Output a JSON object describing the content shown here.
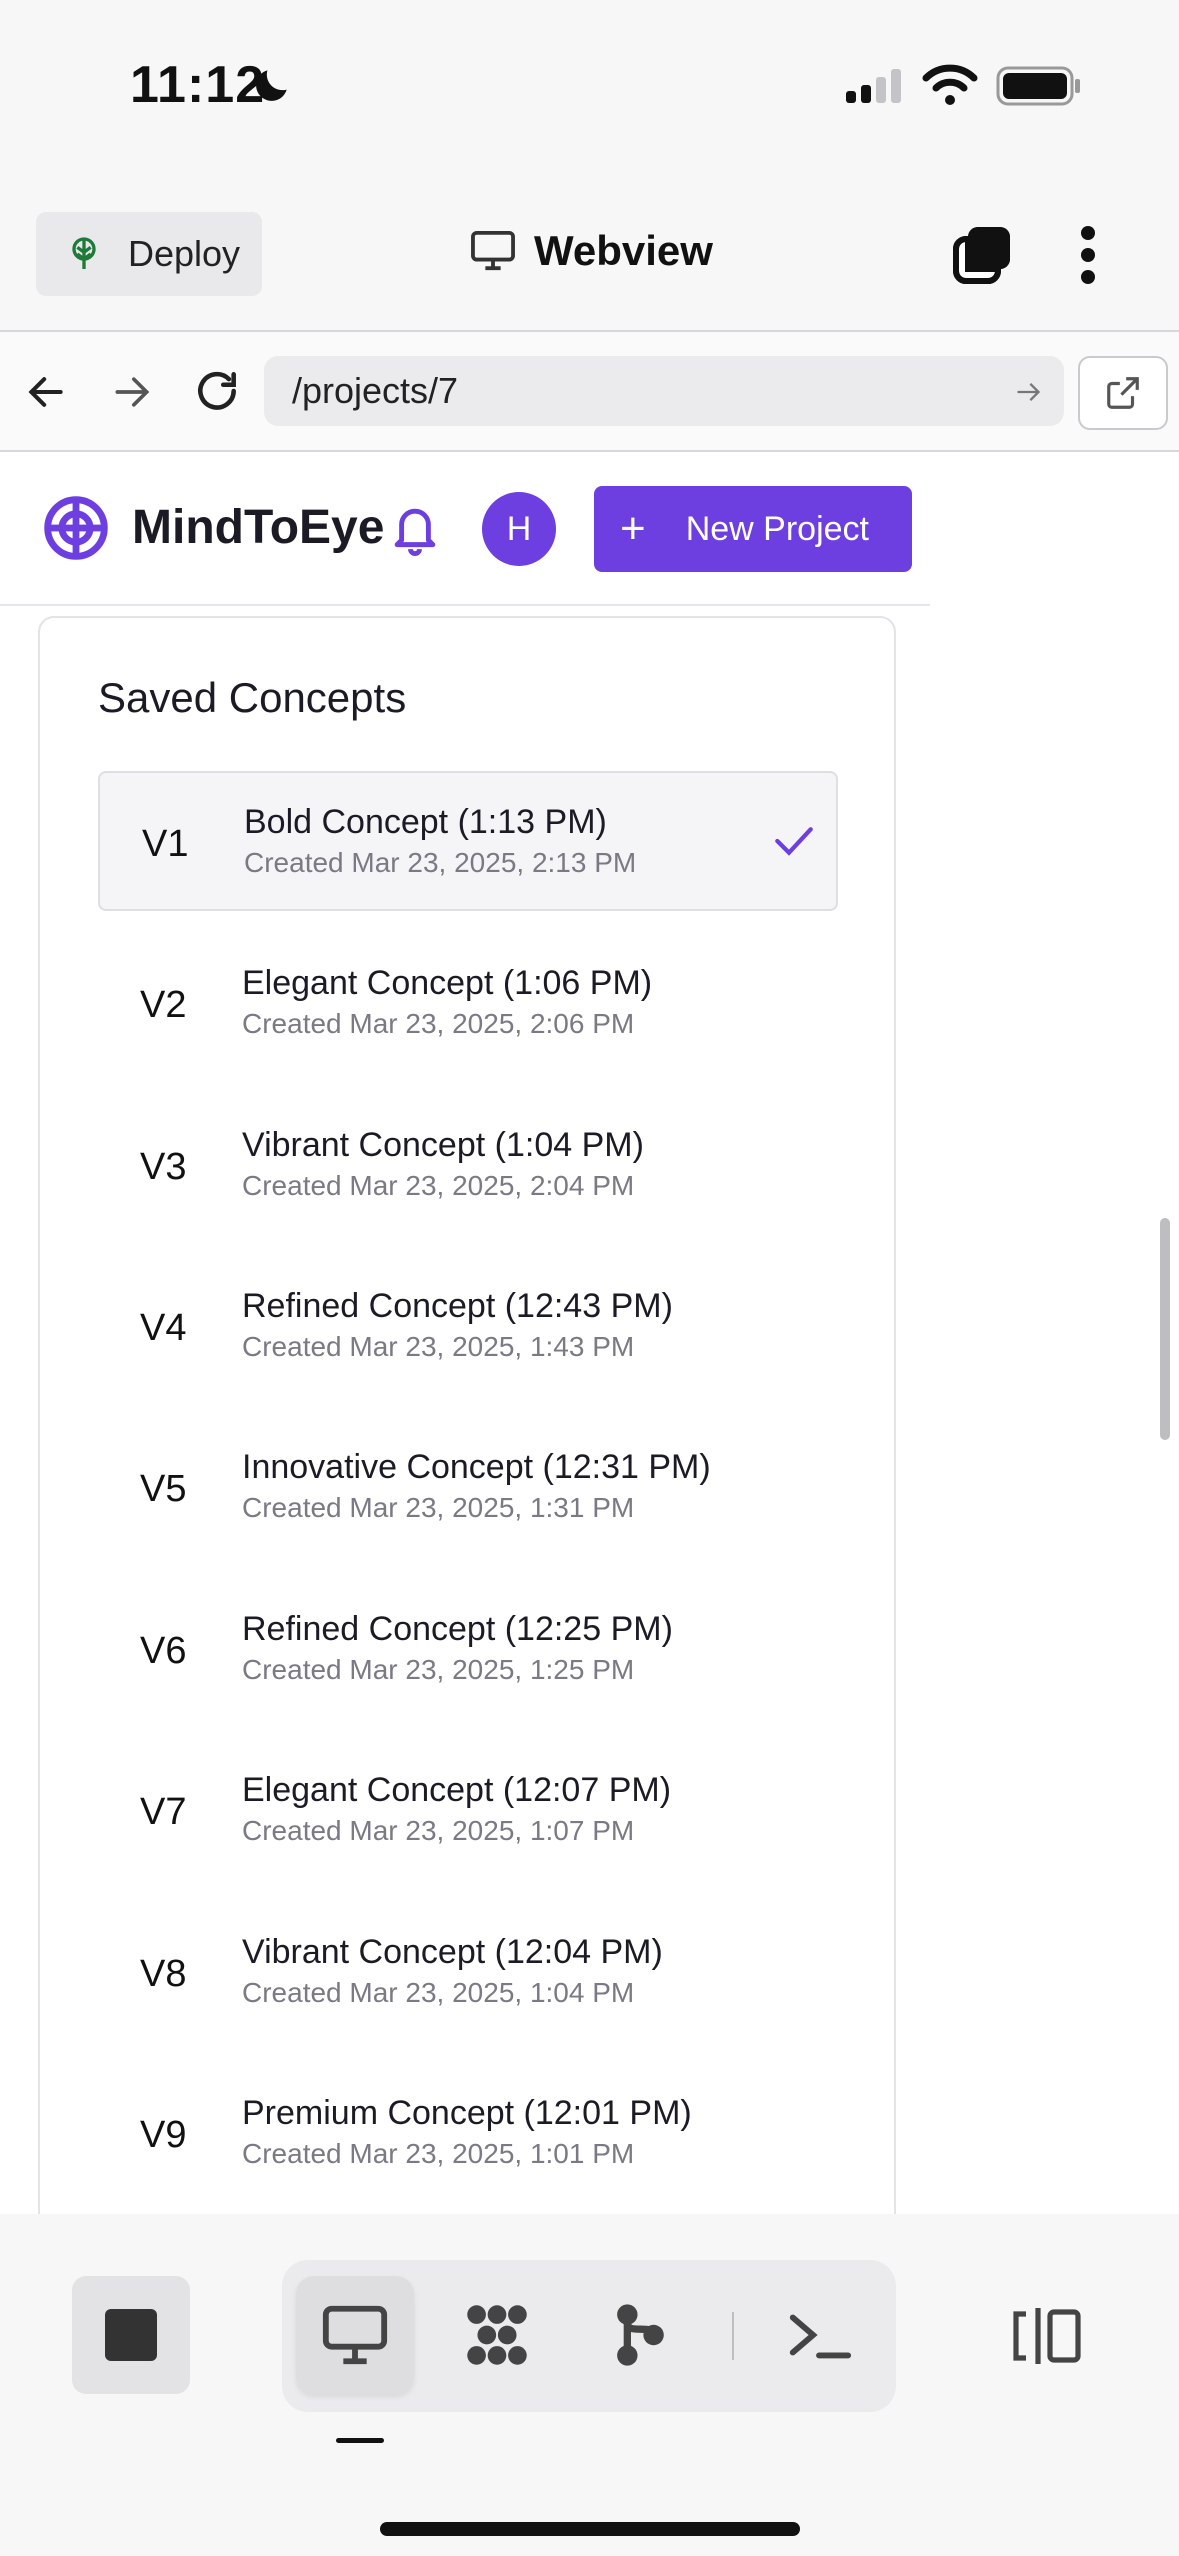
{
  "status_bar": {
    "time": "11:12"
  },
  "app_bar": {
    "deploy_label": "Deploy",
    "title": "Webview"
  },
  "browser": {
    "url": "/projects/7"
  },
  "site": {
    "brand": "MindToEye",
    "avatar_initial": "H",
    "new_project_label": "New Project",
    "accent_color": "#6d3fe0"
  },
  "saved_concepts": {
    "title": "Saved Concepts",
    "items": [
      {
        "version": "V1",
        "title": "Bold Concept (1:13 PM)",
        "created": "Created Mar 23, 2025, 2:13 PM",
        "selected": true
      },
      {
        "version": "V2",
        "title": "Elegant Concept (1:06 PM)",
        "created": "Created Mar 23, 2025, 2:06 PM"
      },
      {
        "version": "V3",
        "title": "Vibrant Concept (1:04 PM)",
        "created": "Created Mar 23, 2025, 2:04 PM"
      },
      {
        "version": "V4",
        "title": "Refined Concept (12:43 PM)",
        "created": "Created Mar 23, 2025, 1:43 PM"
      },
      {
        "version": "V5",
        "title": "Innovative Concept (12:31 PM)",
        "created": "Created Mar 23, 2025, 1:31 PM"
      },
      {
        "version": "V6",
        "title": "Refined Concept (12:25 PM)",
        "created": "Created Mar 23, 2025, 1:25 PM"
      },
      {
        "version": "V7",
        "title": "Elegant Concept (12:07 PM)",
        "created": "Created Mar 23, 2025, 1:07 PM"
      },
      {
        "version": "V8",
        "title": "Vibrant Concept (12:04 PM)",
        "created": "Created Mar 23, 2025, 1:04 PM"
      },
      {
        "version": "V9",
        "title": "Premium Concept (12:01 PM)",
        "created": "Created Mar 23, 2025, 1:01 PM"
      }
    ]
  },
  "bottom_bar": {
    "tools": [
      "monitor-icon",
      "workflow-icon",
      "git-branch-icon",
      "terminal-icon"
    ],
    "active_tool": "monitor-icon"
  }
}
